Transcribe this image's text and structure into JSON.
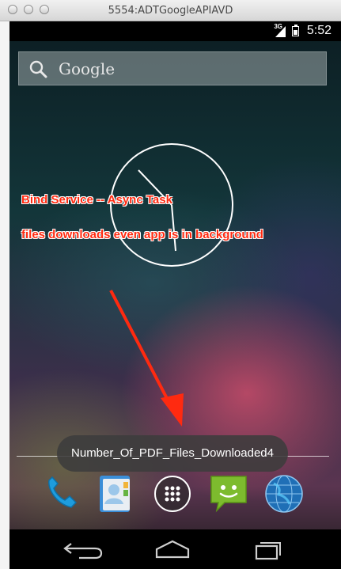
{
  "window": {
    "title": "5554:ADTGoogleAPIAVD",
    "buttons": [
      "close",
      "minimize",
      "zoom"
    ]
  },
  "status_bar": {
    "network": "3G",
    "time": "5:52",
    "icons": [
      "signal-icon",
      "battery-icon"
    ]
  },
  "search": {
    "label": "Google",
    "icon": "search-icon"
  },
  "widgets": {
    "clock": "analog-clock"
  },
  "annotations": {
    "line1": "Bind Service -- Async Task",
    "line2": "files downloads even app is in background",
    "color": "#ff2a10"
  },
  "toast": {
    "text": "Number_Of_PDF_Files_Downloaded4"
  },
  "dock": {
    "items": [
      {
        "name": "Phone",
        "icon": "phone-icon"
      },
      {
        "name": "People",
        "icon": "contacts-icon"
      },
      {
        "name": "Apps",
        "icon": "app-drawer-icon"
      },
      {
        "name": "Messaging",
        "icon": "messaging-icon"
      },
      {
        "name": "Browser",
        "icon": "browser-globe-icon"
      }
    ]
  },
  "nav_bar": {
    "buttons": [
      {
        "name": "Back",
        "icon": "back-icon"
      },
      {
        "name": "Home",
        "icon": "home-icon"
      },
      {
        "name": "Recent apps",
        "icon": "recent-apps-icon"
      }
    ]
  }
}
